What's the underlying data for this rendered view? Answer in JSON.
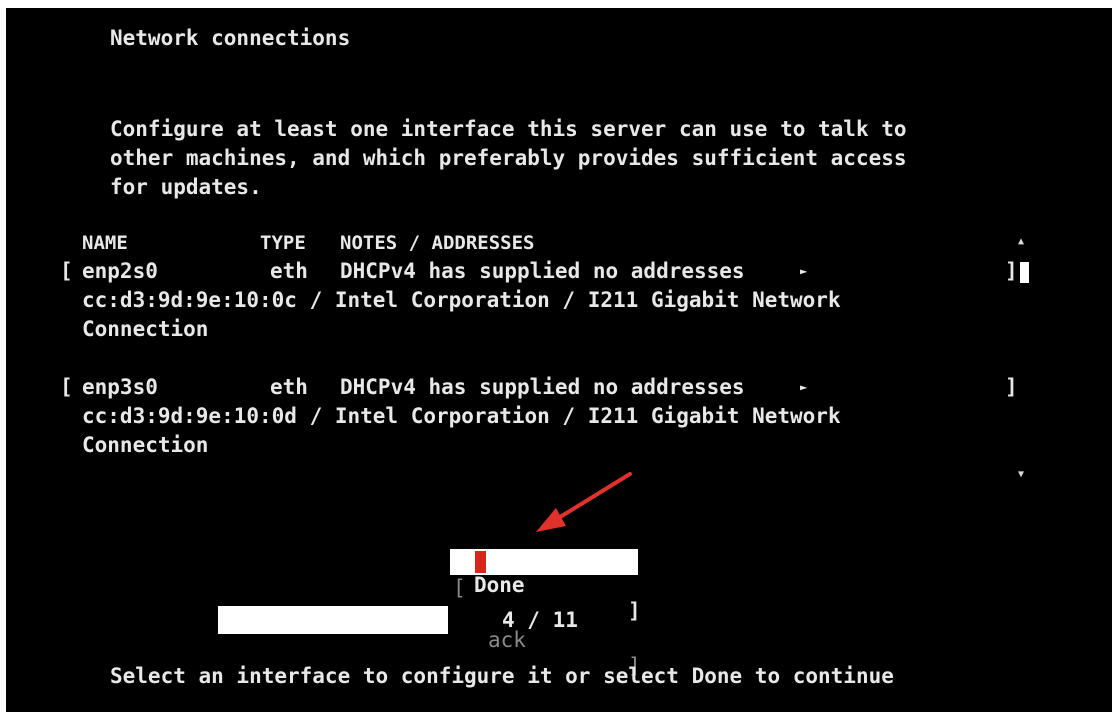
{
  "screen": {
    "title": "Network connections",
    "description": [
      "Configure at least one interface this server can use to talk to",
      "other machines, and which preferably provides sufficient access",
      "for updates."
    ],
    "table": {
      "headers": {
        "name": "NAME",
        "type": "TYPE",
        "notes": "NOTES / ADDRESSES"
      },
      "rows": [
        {
          "open": "[",
          "name": "enp2s0",
          "type": "eth",
          "notes": "DHCPv4 has supplied no addresses",
          "arrow": "►",
          "close": "]",
          "detail_1": "cc:d3:9d:9e:10:0c / Intel Corporation / I211 Gigabit Network",
          "detail_2": "Connection"
        },
        {
          "open": "[",
          "name": "enp3s0",
          "type": "eth",
          "notes": "DHCPv4 has supplied no addresses",
          "arrow": "►",
          "close": "]",
          "detail_1": "cc:d3:9d:9e:10:0d / Intel Corporation / I211 Gigabit Network",
          "detail_2": "Connection"
        }
      ]
    },
    "scrollbar": {
      "up_icon": "triangle-up",
      "down_icon": "triangle-down"
    },
    "buttons": {
      "done": {
        "open": "[",
        "label": "Done",
        "close": "]"
      },
      "back": {
        "open": "[",
        "label": "ack",
        "close": "]"
      }
    },
    "progress": {
      "text": "4 / 11",
      "current": 4,
      "total": 11
    },
    "footer": "Select an interface to configure it or select Done to continue",
    "annotation": {
      "arrow_color": "#e0322b",
      "cursor_color": "#d7261e"
    }
  }
}
